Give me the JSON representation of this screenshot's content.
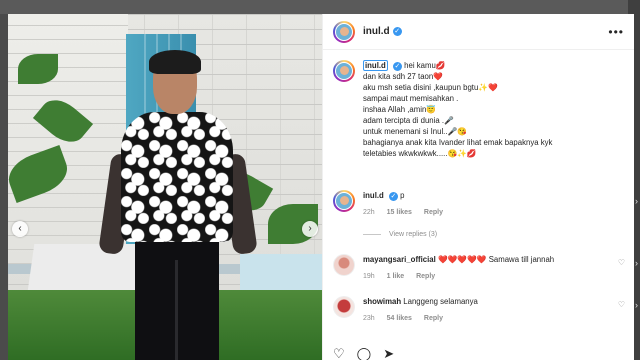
{
  "post": {
    "username": "inul.d",
    "verified_mark": "✓",
    "more_label": "•••",
    "caption_lines": [
      "hei kamu💋",
      "dan kita sdh 27 taon❤️",
      "aku msh setia disini ,kaupun bgtu✨❤️",
      "sampai maut memisahkan .",
      "inshaa Allah ,amin😇",
      "adam tercipta di dunia .🎤",
      "untuk menemani si Inul..🎤😘",
      "bahagianya anak kita Ivander lihat emak bapaknya kyk",
      "teletabies wkwkwkwk.....😘✨💋"
    ]
  },
  "photo": {
    "prev_label": "‹",
    "next_label": "›"
  },
  "comments": [
    {
      "username": "inul.d",
      "verified": true,
      "text": "p",
      "time": "22h",
      "likes": "15 likes",
      "reply": "Reply"
    },
    {
      "username": "mayangsari_official",
      "verified": false,
      "text": "❤️❤️❤️❤️❤️ Samawa till jannah",
      "time": "19h",
      "likes": "1 like",
      "reply": "Reply"
    },
    {
      "username": "showimah",
      "verified": false,
      "text": "Langgeng selamanya",
      "time": "23h",
      "likes": "54 likes",
      "reply": "Reply"
    }
  ],
  "view_replies": "View replies (3)",
  "actions": {
    "like_icon": "♡",
    "comment_icon": "◯",
    "share_icon": "➤",
    "save_icon": "⌑"
  },
  "side_arrows": [
    "›",
    "›",
    "›"
  ],
  "colors": {
    "verified": "#3897f0",
    "meta": "#8e8e8e"
  }
}
